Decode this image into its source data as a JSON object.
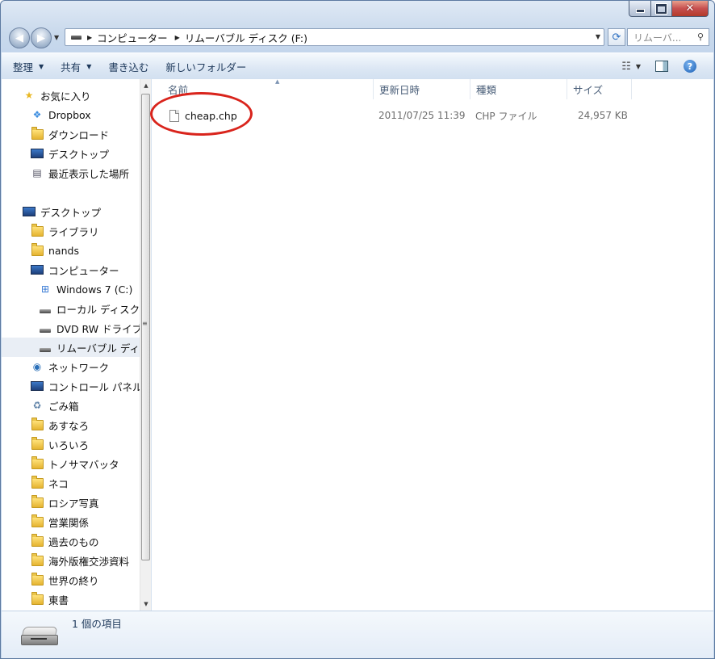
{
  "window": {
    "minimize_glyph": "",
    "maximize_glyph": "",
    "close_glyph": "✕"
  },
  "address": {
    "crumbs": [
      "コンピューター",
      "リムーバブル ディスク (F:)"
    ],
    "search_placeholder": "リムーバ..."
  },
  "toolbar": {
    "organize": "整理",
    "share": "共有",
    "burn": "書き込む",
    "new_folder": "新しいフォルダー"
  },
  "nav": {
    "favorites": "お気に入り",
    "dropbox": "Dropbox",
    "downloads": "ダウンロード",
    "desktop_fav": "デスクトップ",
    "recent": "最近表示した場所",
    "desktop": "デスクトップ",
    "libraries": "ライブラリ",
    "user": "nands",
    "computer": "コンピューター",
    "drive_c": "Windows 7 (C:)",
    "local_disk": "ローカル ディスク",
    "dvd": "DVD RW ドライブ",
    "removable": "リムーバブル ディス",
    "network": "ネットワーク",
    "control_panel": "コントロール パネル",
    "recycle": "ごみ箱",
    "folders": [
      "あすなろ",
      "いろいろ",
      "トノサマバッタ",
      "ネコ",
      "ロシア写真",
      "営業関係",
      "過去のもの",
      "海外版権交渉資料",
      "世界の終り",
      "東書"
    ]
  },
  "columns": {
    "name": "名前",
    "modified": "更新日時",
    "type": "種類",
    "size": "サイズ"
  },
  "files": [
    {
      "name": "cheap.chp",
      "modified": "2011/07/25 11:39",
      "type": "CHP ファイル",
      "size": "24,957 KB"
    }
  ],
  "details": {
    "count": "1 個の項目"
  },
  "colors": {
    "highlight_circle": "#d9241c",
    "toolbar_text": "#1e395b"
  }
}
